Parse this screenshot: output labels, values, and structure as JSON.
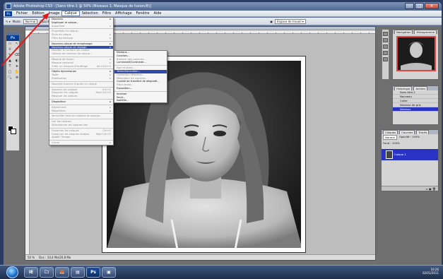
{
  "window": {
    "title": "Adobe Photoshop CS3 - [Sans titre-1 @ 50% (Niveaux 1, Masque de fusion/8)]",
    "buttons": [
      "–",
      "□",
      "×"
    ]
  },
  "menubar": {
    "app_badge": "Ps",
    "items": [
      "Fichier",
      "Edition",
      "Image",
      "Calque",
      "Sélection",
      "Filtre",
      "Affichage",
      "Fenêtre",
      "Aide"
    ],
    "active_index": 3
  },
  "optionsbar": {
    "mode_label": "Mode:",
    "mode_value": "Normal",
    "opacity_label": "Opacité :",
    "opacity_value": "100%",
    "flow_label": "Flux :",
    "flow_value": "100%",
    "workspace_label": "Espace de travail ▾"
  },
  "toolbox": {
    "badge": "Ps",
    "tools": [
      "▭",
      "↖",
      "⌾",
      "✂",
      "✎",
      "⌫",
      "▲",
      "◐",
      "T",
      "➤",
      "□",
      "✋",
      "🔍",
      "⊕"
    ]
  },
  "layer_menu": {
    "items": [
      {
        "label": "Nouveau",
        "arrow": true,
        "state": "normal"
      },
      {
        "label": "Dupliquer le calque...",
        "arrow": false,
        "state": "normal"
      },
      {
        "label": "Supprimer",
        "arrow": true,
        "state": "dim"
      },
      {
        "sep": true
      },
      {
        "label": "Propriétés du calque...",
        "arrow": false,
        "state": "dim"
      },
      {
        "label": "Style de calque",
        "arrow": true,
        "state": "dim"
      },
      {
        "label": "Filtre dynamique",
        "arrow": true,
        "state": "dim"
      },
      {
        "sep": true
      },
      {
        "label": "Nouveau calque de remplissage",
        "arrow": true,
        "state": "normal"
      },
      {
        "label": "Nouveau calque de réglage",
        "arrow": true,
        "state": "hl"
      },
      {
        "label": "Modifier le contenu du calque",
        "arrow": false,
        "state": "dim"
      },
      {
        "label": "Options de contenu de calque...",
        "arrow": false,
        "state": "dim"
      },
      {
        "sep": true
      },
      {
        "label": "Masque de fusion",
        "arrow": true,
        "state": "dim"
      },
      {
        "label": "Masque vectoriel",
        "arrow": true,
        "state": "dim"
      },
      {
        "label": "Créer un masque d'écrêtage",
        "shortcut": "Alt+Ctrl+G",
        "arrow": false,
        "state": "dim"
      },
      {
        "sep": true
      },
      {
        "label": "Objets dynamiques",
        "arrow": true,
        "state": "normal"
      },
      {
        "label": "Texte",
        "arrow": true,
        "state": "dim"
      },
      {
        "label": "Pixellisation",
        "arrow": true,
        "state": "dim"
      },
      {
        "sep": true
      },
      {
        "label": "Nouvelle tranche d'après un calque",
        "arrow": false,
        "state": "dim"
      },
      {
        "sep": true
      },
      {
        "label": "Associer les calques",
        "shortcut": "Ctrl+G",
        "arrow": false,
        "state": "dim"
      },
      {
        "label": "Dissocier les calques",
        "shortcut": "Maj+Ctrl+G",
        "arrow": false,
        "state": "dim"
      },
      {
        "label": "Masquer les calques",
        "arrow": false,
        "state": "dim"
      },
      {
        "sep": true
      },
      {
        "label": "Disposition",
        "arrow": true,
        "state": "normal"
      },
      {
        "sep": true
      },
      {
        "label": "Alignement",
        "arrow": true,
        "state": "dim"
      },
      {
        "label": "Répartition",
        "arrow": true,
        "state": "dim"
      },
      {
        "sep": true
      },
      {
        "label": "Verrouiller tous les calques du groupe...",
        "arrow": false,
        "state": "dim"
      },
      {
        "sep": true
      },
      {
        "label": "Lier les calques",
        "arrow": false,
        "state": "dim"
      },
      {
        "label": "Sélectionner les calques liés",
        "arrow": false,
        "state": "dim"
      },
      {
        "sep": true
      },
      {
        "label": "Fusionner les calques",
        "shortcut": "Ctrl+E",
        "arrow": false,
        "state": "dim"
      },
      {
        "label": "Fusionner les calques visibles",
        "shortcut": "Maj+Ctrl+E",
        "arrow": false,
        "state": "dim"
      },
      {
        "label": "Aplatir l'image",
        "arrow": false,
        "state": "dim"
      },
      {
        "sep": true
      },
      {
        "label": "Cache",
        "arrow": true,
        "state": "dim"
      }
    ]
  },
  "adjust_submenu": {
    "items": [
      {
        "label": "Niveaux...",
        "state": "normal"
      },
      {
        "label": "Courbes...",
        "state": "normal"
      },
      {
        "label": "Balance des couleurs...",
        "state": "dim"
      },
      {
        "label": "Luminosité/Contraste...",
        "state": "normal"
      },
      {
        "sep": true
      },
      {
        "label": "Noir et blanc...",
        "state": "dim"
      },
      {
        "label": "Teinte/Saturation...",
        "state": "hl"
      },
      {
        "label": "Correction sélective...",
        "state": "dim"
      },
      {
        "label": "Mélangeur de couches...",
        "state": "dim"
      },
      {
        "label": "Courbe de transfert de dégradé...",
        "state": "normal"
      },
      {
        "label": "Filtre photo...",
        "state": "dim"
      },
      {
        "label": "Exposition...",
        "state": "normal"
      },
      {
        "sep": true
      },
      {
        "label": "Inverser",
        "state": "normal"
      },
      {
        "label": "Seuil...",
        "state": "normal"
      },
      {
        "label": "Isohélie...",
        "state": "normal"
      }
    ]
  },
  "document": {
    "zoom": "50 %",
    "doc_info": "Doc : 10,4 Mo/20,8 Mo"
  },
  "panels": {
    "navigator_tabs": [
      "Navigation",
      "Histogramme",
      "Informations"
    ],
    "history_tabs": [
      "Historique",
      "Actions"
    ],
    "history_items": [
      "Sans titre-1",
      "Nouveau",
      "Coller",
      "Niveaux de gris",
      "Niveaux"
    ],
    "layers_tabs": [
      "Calques",
      "Couches",
      "Tracés"
    ],
    "layers_mode": "Normal",
    "layers_opacity": "Opacité : 100%",
    "layers_fill": "Fond : 100%",
    "layer_name": "Calque 1"
  },
  "taskbar": {
    "icons": [
      "IE",
      "🗀",
      "🦊",
      "▤",
      "Ps",
      "▣"
    ],
    "time": "10:26",
    "date": "02/01/2011"
  },
  "colors": {
    "menu_highlight": "#2f4aa8",
    "layer_selected": "#2a34c4",
    "annotation_arrow": "#e01818"
  }
}
